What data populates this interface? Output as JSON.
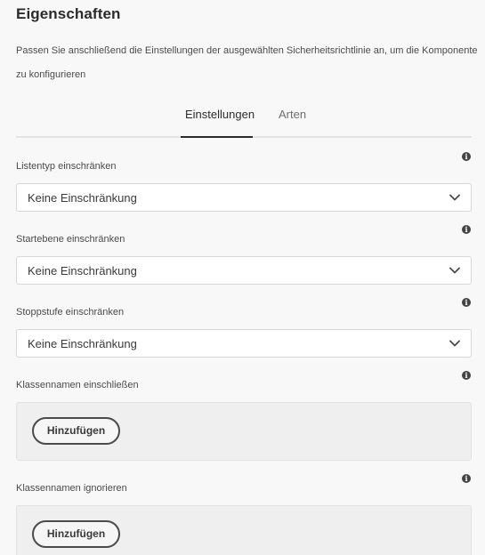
{
  "header": {
    "title": "Eigenschaften",
    "description": "Passen Sie anschließend die Einstellungen der ausgewählten Sicherheitsrichtlinie an, um die Komponente zu konfigurieren"
  },
  "tabs": [
    {
      "label": "Einstellungen",
      "active": true
    },
    {
      "label": "Arten",
      "active": false
    }
  ],
  "fields": {
    "list_type": {
      "label": "Listentyp einschränken",
      "value": "Keine Einschränkung"
    },
    "start_level": {
      "label": "Startebene einschränken",
      "value": "Keine Einschränkung"
    },
    "stop_level": {
      "label": "Stoppstufe einschränken",
      "value": "Keine Einschränkung"
    },
    "include_classes": {
      "label": "Klassennamen einschließen",
      "add_label": "Hinzufügen"
    },
    "ignore_classes": {
      "label": "Klassennamen ignorieren",
      "add_label": "Hinzufügen"
    }
  },
  "icons": {
    "info": "info-icon",
    "dropdown": "chevron-down-icon"
  },
  "colors": {
    "background": "#f8f8f8",
    "text": "#2c2c2c",
    "tab_indicator": "#2c2c2c",
    "field_background": "#ffffff",
    "multifield_background": "#efefef"
  }
}
